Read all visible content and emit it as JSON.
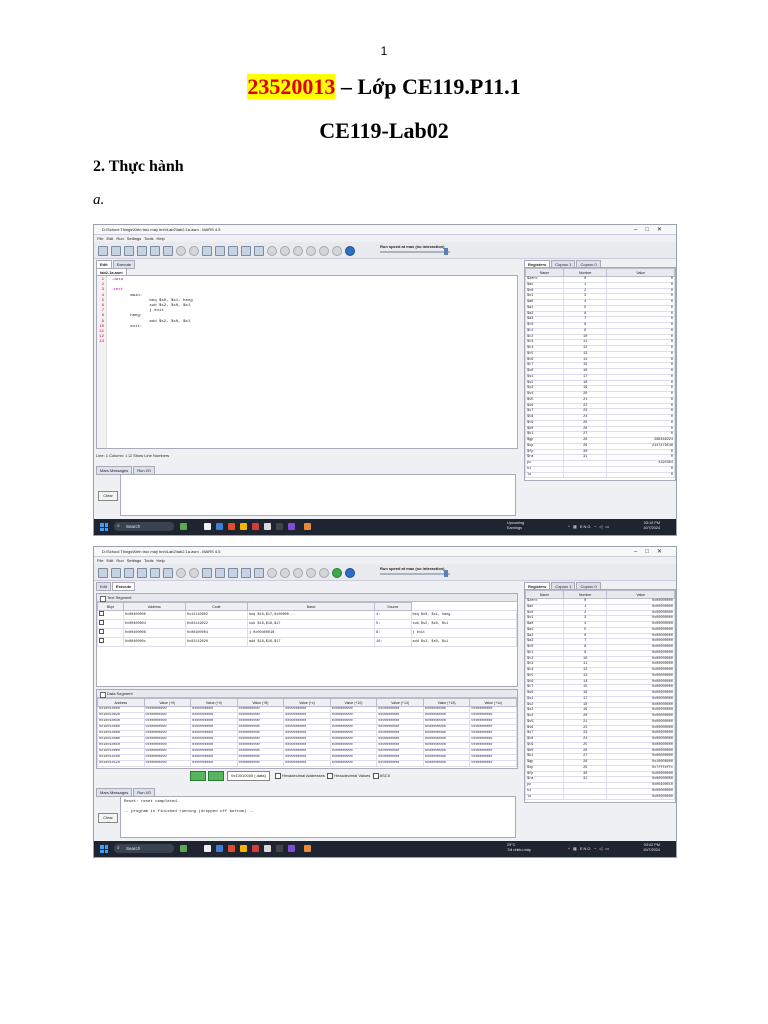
{
  "page": {
    "number": "1"
  },
  "header": {
    "student_id": "23520013",
    "title_rest": " – Lớp CE119.P11.1",
    "lab_title": "CE119-Lab02"
  },
  "section": {
    "heading": "2. Thực hành",
    "sub": "a."
  },
  "screenshot1": {
    "window_title": "D:\\School Things\\Kiến trúc máy tính\\Lab2\\lab2.1a.asm - MARS 4.5",
    "menu": [
      "File",
      "Edit",
      "Run",
      "Settings",
      "Tools",
      "Help"
    ],
    "run_speed": "Run speed at max (no interaction)",
    "tabs": [
      "Edit",
      "Execute"
    ],
    "file_tab": "lab2.1a.asm",
    "code_lines": [
      ".data",
      "",
      ".text",
      "        main:",
      "                beq $s0, $s1, hang",
      "                sub $s2, $s0, $s1",
      "                j exit",
      "        hang:",
      "                add $s2, $s0, $s1",
      "        exit:",
      "",
      "",
      ""
    ],
    "line_numbers": [
      "1",
      "2",
      "3",
      "4",
      "5",
      "6",
      "7",
      "8",
      "9",
      "10",
      "11",
      "12",
      "13"
    ],
    "status": "Line: 1 Column: 1  ☑ Show Line Numbers",
    "msg_tabs": [
      "Mars Messages",
      "Run I/O"
    ],
    "clear": "Clear",
    "weather_1": "Upcoming",
    "weather_2": "Earnings",
    "time": "03:10 PM",
    "date": "10/7/2024"
  },
  "screenshot2": {
    "window_title": "D:\\School Things\\Kiến trúc máy tính\\Lab2\\lab2.1a.asm - MARS 4.5",
    "text_segment": "Text Segment",
    "text_headers": [
      "Bkpt",
      "Address",
      "Code",
      "Basic",
      "Source"
    ],
    "text_rows": [
      [
        "0x00400000",
        "0x12110002",
        "beq $16,$17,0x00000...",
        "4:",
        "beq $s0, $s1, hang"
      ],
      [
        "0x00400004",
        "0x02119022",
        "sub $18,$16,$17",
        "5:",
        "sub $s2, $s0, $s1"
      ],
      [
        "0x00400008",
        "0x08100004",
        "j 0x00400010",
        "6:",
        "j exit"
      ],
      [
        "0x0040000c",
        "0x02119020",
        "add $18,$16,$17",
        "10:",
        "add $s2, $s0, $s1"
      ]
    ],
    "data_segment": "Data Segment",
    "data_headers": [
      "Address",
      "Value (+0)",
      "Value (+4)",
      "Value (+8)",
      "Value (+c)",
      "Value (+10)",
      "Value (+14)",
      "Value (+18)",
      "Value (+1c)"
    ],
    "data_addresses": [
      "0x10010000",
      "0x10010020",
      "0x10010040",
      "0x10010060",
      "0x10010080",
      "0x100100a0",
      "0x100100c0",
      "0x100100e0",
      "0x10010100",
      "0x10010120"
    ],
    "data_value": "0x00000000",
    "nav_select": "0x10010000 (.data)",
    "nav_hex_addr": "Hexadecimal Addresses",
    "nav_hex_val": "Hexadecimal Values",
    "nav_ascii": "ASCII",
    "messages": [
      "Reset: reset completed.",
      "",
      "-- program is finished running (dropped off bottom) --"
    ],
    "weather_1": "29°C",
    "weather_2": "Tối nhiều mây",
    "time": "03:02 PM",
    "date": "10/7/2024"
  },
  "registers": {
    "tabs": [
      "Registers",
      "Coproc 1",
      "Coproc 0"
    ],
    "headers": [
      "Name",
      "Number",
      "Value"
    ],
    "names": [
      "$zero",
      "$at",
      "$v0",
      "$v1",
      "$a0",
      "$a1",
      "$a2",
      "$a3",
      "$t0",
      "$t1",
      "$t2",
      "$t3",
      "$t4",
      "$t5",
      "$t6",
      "$t7",
      "$s0",
      "$s1",
      "$s2",
      "$s3",
      "$s4",
      "$s5",
      "$s6",
      "$s7",
      "$t8",
      "$t9",
      "$k0",
      "$k1",
      "$gp",
      "$sp",
      "$fp",
      "$ra",
      "pc",
      "hi",
      "lo"
    ],
    "numbers": [
      "0",
      "1",
      "2",
      "3",
      "4",
      "5",
      "6",
      "7",
      "8",
      "9",
      "10",
      "11",
      "12",
      "13",
      "14",
      "15",
      "16",
      "17",
      "18",
      "19",
      "20",
      "21",
      "22",
      "23",
      "24",
      "25",
      "26",
      "27",
      "28",
      "29",
      "30",
      "31",
      "",
      "",
      ""
    ],
    "values_dec": [
      "0",
      "0",
      "0",
      "0",
      "0",
      "0",
      "0",
      "0",
      "0",
      "0",
      "0",
      "0",
      "0",
      "0",
      "0",
      "0",
      "0",
      "0",
      "0",
      "0",
      "0",
      "0",
      "0",
      "0",
      "0",
      "0",
      "0",
      "0",
      "268468224",
      "2147479548",
      "0",
      "0",
      "4194304",
      "0",
      "0"
    ],
    "values_hex": [
      "0x00000000",
      "0x00000000",
      "0x00000000",
      "0x00000000",
      "0x00000000",
      "0x00000000",
      "0x00000000",
      "0x00000000",
      "0x00000000",
      "0x00000000",
      "0x00000000",
      "0x00000000",
      "0x00000000",
      "0x00000000",
      "0x00000000",
      "0x00000000",
      "0x00000000",
      "0x00000000",
      "0x00000000",
      "0x00000000",
      "0x00000000",
      "0x00000000",
      "0x00000000",
      "0x00000000",
      "0x00000000",
      "0x00000000",
      "0x00000000",
      "0x00000000",
      "0x10008000",
      "0x7fffeffc",
      "0x00000000",
      "0x00000000",
      "0x00400010",
      "0x00000000",
      "0x00000000"
    ]
  }
}
